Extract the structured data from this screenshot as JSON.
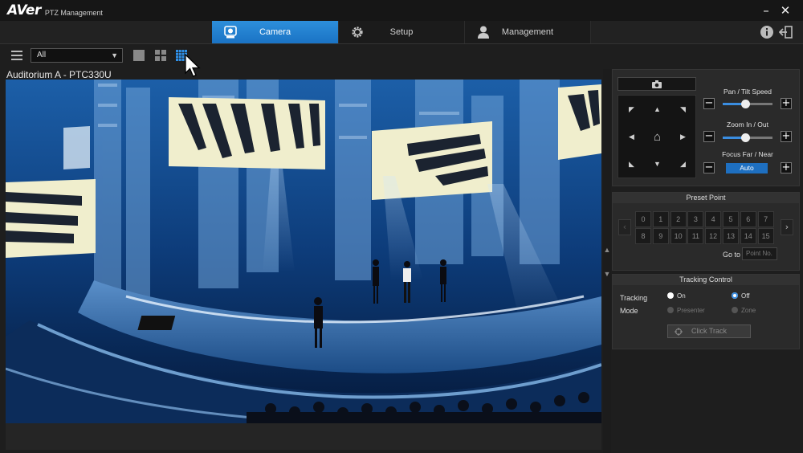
{
  "app": {
    "logo": "AVer",
    "title": "PTZ Management"
  },
  "window": {
    "minimize": "–",
    "close": "✕"
  },
  "nav": {
    "tabs": [
      {
        "label": "Camera",
        "icon": "camera-tab-icon",
        "active": true
      },
      {
        "label": "Setup",
        "icon": "gear-icon",
        "active": false
      },
      {
        "label": "Management",
        "icon": "user-icon",
        "active": false
      }
    ],
    "info_icon": "info-icon",
    "logout_icon": "logout-icon"
  },
  "toolbar": {
    "group_select": {
      "value": "All",
      "caret": "▼"
    },
    "layouts": [
      "single-layout-icon",
      "quad-layout-icon",
      "grid-layout-icon"
    ]
  },
  "camera": {
    "name": "Auditorium A - PTC330U"
  },
  "splitter": {
    "up": "▲",
    "down": "▼"
  },
  "ptz": {
    "snapshot_icon": "camera-snapshot-icon",
    "pan_tilt_label": "Pan / Tilt Speed",
    "pan_tilt_level": 0.45,
    "zoom_label": "Zoom In / Out",
    "zoom_level": 0.45,
    "focus_label": "Focus Far / Near",
    "focus_auto": "Auto",
    "minus": "−",
    "plus": "+",
    "dpad": {
      "up_left": "◤",
      "up": "▲",
      "up_right": "◥",
      "left": "◀",
      "home": "⌂",
      "right": "▶",
      "down_left": "◣",
      "down": "▼",
      "down_right": "◢"
    }
  },
  "preset": {
    "title": "Preset Point",
    "row1": [
      "0",
      "1",
      "2",
      "3",
      "4",
      "5",
      "6",
      "7"
    ],
    "row2": [
      "8",
      "9",
      "10",
      "11",
      "12",
      "13",
      "14",
      "15"
    ],
    "prev": "‹",
    "next": "›",
    "goto_label": "Go to",
    "goto_placeholder": "Point No."
  },
  "tracking": {
    "title": "Tracking Control",
    "tracking_label": "Tracking",
    "mode_label": "Mode",
    "on": "On",
    "off": "Off",
    "presenter": "Presenter",
    "zone": "Zone",
    "click_track": "Click Track"
  },
  "colors": {
    "accent": "#1a73c4",
    "background": "#1e1e1e",
    "panel": "#2a2a2a"
  }
}
